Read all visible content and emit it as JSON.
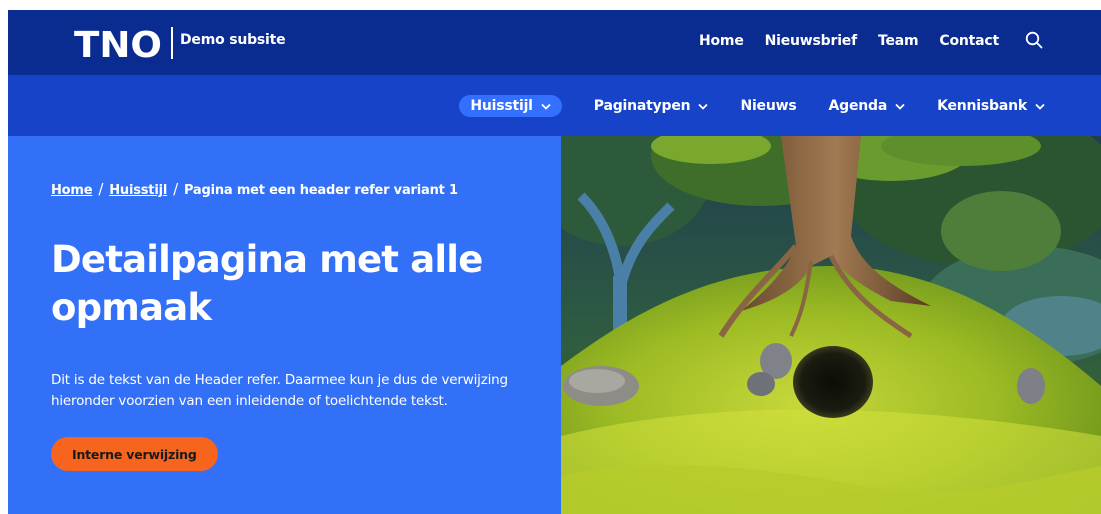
{
  "brand": {
    "logo_text": "TNO",
    "subsite": "Demo subsite"
  },
  "topnav": {
    "items": [
      "Home",
      "Nieuwsbrief",
      "Team",
      "Contact"
    ],
    "search_icon": "search-icon"
  },
  "mainnav": {
    "items": [
      {
        "label": "Huisstijl",
        "dropdown": true,
        "active": true
      },
      {
        "label": "Paginatypen",
        "dropdown": true
      },
      {
        "label": "Nieuws",
        "dropdown": false
      },
      {
        "label": "Agenda",
        "dropdown": true
      },
      {
        "label": "Kennisbank",
        "dropdown": true
      }
    ]
  },
  "breadcrumb": {
    "items": [
      "Home",
      "Huisstijl"
    ],
    "separator": "/",
    "current": "Pagina met een header refer variant 1"
  },
  "hero": {
    "title": "Detailpagina met alle opmaak",
    "text": "Dit is de tekst van de Header refer. Daarmee kun je dus de verwijzing hieronder voorzien van een inleidende of toelichtende tekst.",
    "cta_label": "Interne verwijzing"
  },
  "colors": {
    "topbar": "#0a2b8f",
    "mainnav": "#1743c8",
    "hero": "#3370f8",
    "cta": "#f7641e"
  }
}
